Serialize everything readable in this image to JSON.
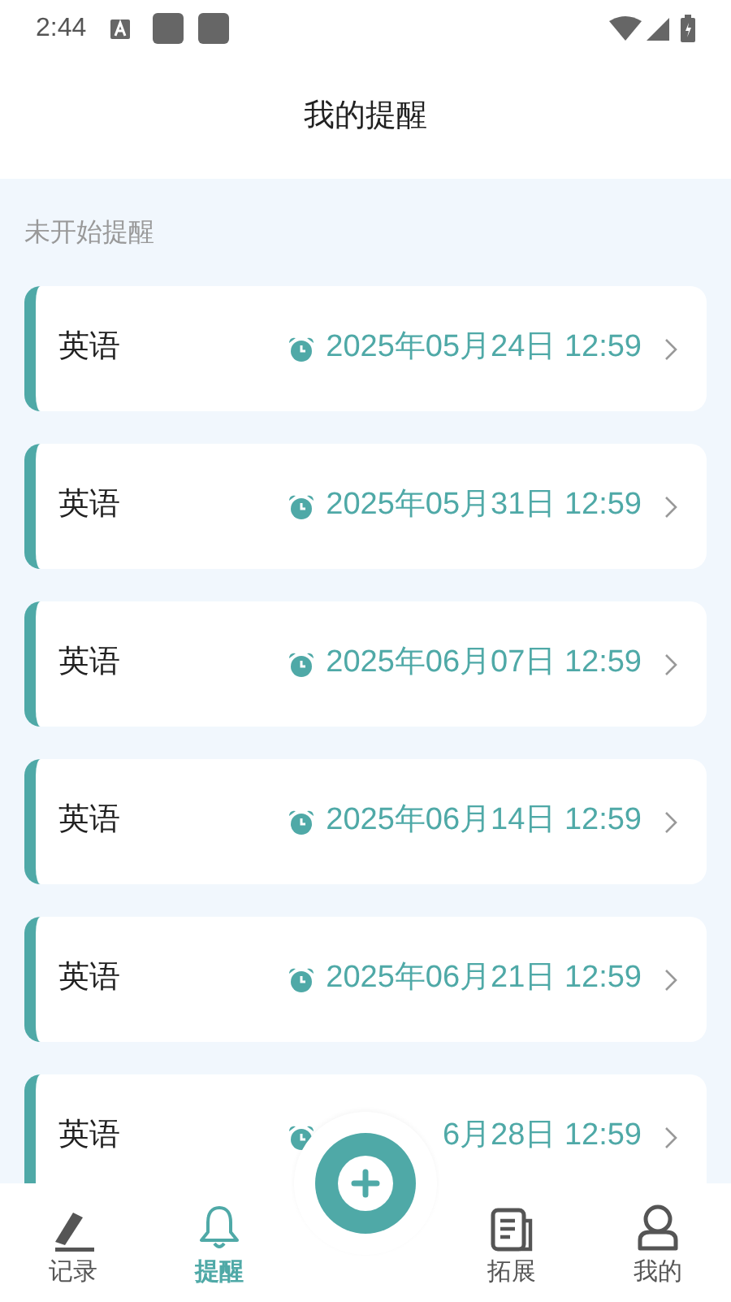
{
  "status_bar": {
    "time": "2:44"
  },
  "header": {
    "title": "我的提醒"
  },
  "section": {
    "title": "未开始提醒"
  },
  "reminders": [
    {
      "subject": "英语",
      "datetime": "2025年05月24日 12:59"
    },
    {
      "subject": "英语",
      "datetime": "2025年05月31日 12:59"
    },
    {
      "subject": "英语",
      "datetime": "2025年06月07日 12:59"
    },
    {
      "subject": "英语",
      "datetime": "2025年06月14日 12:59"
    },
    {
      "subject": "英语",
      "datetime": "2025年06月21日 12:59"
    },
    {
      "subject": "英语",
      "datetime": "6月28日 12:59"
    }
  ],
  "tabs": [
    {
      "label": "记录",
      "selected": false
    },
    {
      "label": "提醒",
      "selected": true
    },
    {
      "label": "拓展",
      "selected": false
    },
    {
      "label": "我的",
      "selected": false
    }
  ]
}
